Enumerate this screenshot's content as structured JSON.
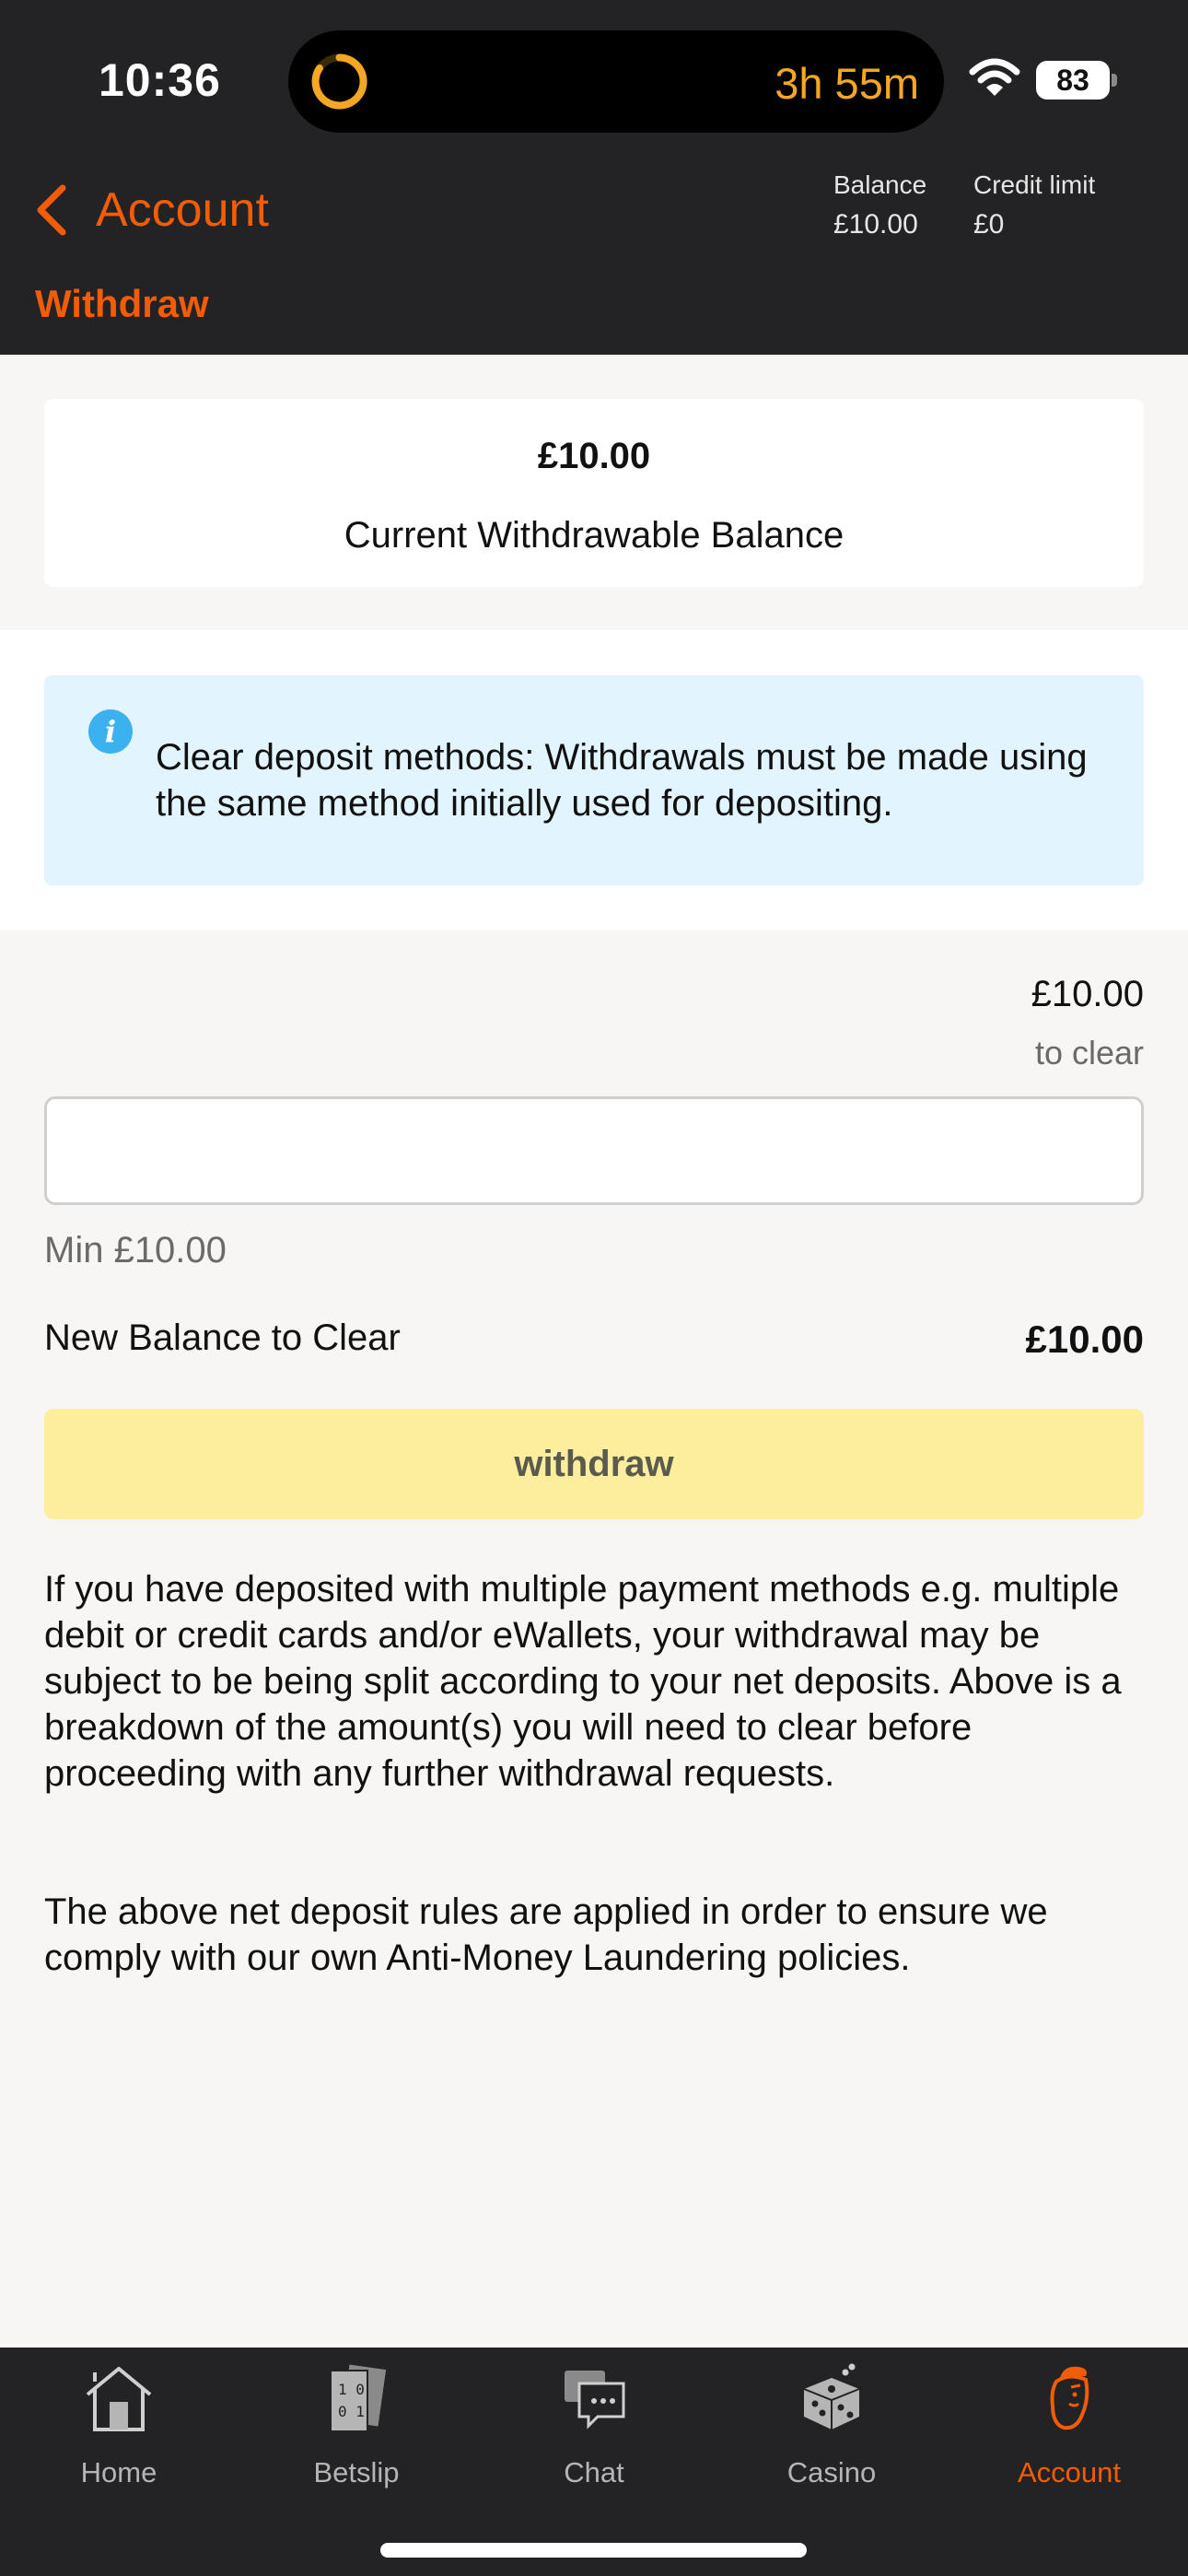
{
  "status_bar": {
    "time": "10:36",
    "timer": "3h 55m",
    "battery": "83"
  },
  "header": {
    "back_label": "Account",
    "title": "Withdraw",
    "balance_label": "Balance",
    "balance_value": "£10.00",
    "credit_label": "Credit limit",
    "credit_value": "£0"
  },
  "balance_card": {
    "amount": "£10.00",
    "label": "Current Withdrawable Balance"
  },
  "info": {
    "icon": "info-icon",
    "text": "Clear deposit methods: Withdrawals must be made using the same method initially used for depositing."
  },
  "withdraw_form": {
    "clear_amount": "£10.00",
    "clear_label": "to clear",
    "input_value": "",
    "min_label": "Min £10.00",
    "new_balance_label": "New Balance to Clear",
    "new_balance_value": "£10.00",
    "button_label": "withdraw"
  },
  "notes": {
    "paragraph1": "If you have deposited with multiple payment methods e.g. multiple debit or credit cards and/or eWallets, your withdrawal may be subject to be being split according to your net deposits. Above is a breakdown of the amount(s) you will need to clear before proceeding with any further withdrawal requests.",
    "paragraph2": "The above net deposit rules are applied in order to ensure we comply with our own Anti-Money Laundering policies."
  },
  "tabs": [
    {
      "label": "Home",
      "icon": "home-icon",
      "active": false
    },
    {
      "label": "Betslip",
      "icon": "betslip-icon",
      "active": false
    },
    {
      "label": "Chat",
      "icon": "chat-icon",
      "active": false
    },
    {
      "label": "Casino",
      "icon": "dice-icon",
      "active": false
    },
    {
      "label": "Account",
      "icon": "account-icon",
      "active": true
    }
  ],
  "colors": {
    "accent": "#f25c05",
    "header_bg": "#232325",
    "info_bg": "#e2f4fd",
    "button_bg": "#fdee9d",
    "timer": "#f5a623"
  }
}
